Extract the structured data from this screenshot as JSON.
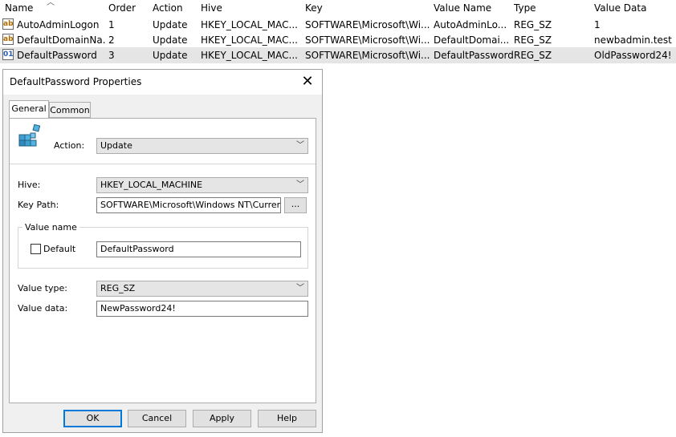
{
  "list": {
    "columns": [
      "Name",
      "Order",
      "Action",
      "Hive",
      "Key",
      "Value Name",
      "Type",
      "Value Data"
    ],
    "rows": [
      {
        "icon": "string-value-icon",
        "name": "AutoAdminLogon",
        "order": "1",
        "action": "Update",
        "hive": "HKEY_LOCAL_MAC...",
        "key": "SOFTWARE\\Microsoft\\Wi...",
        "value_name": "AutoAdminLo...",
        "type": "REG_SZ",
        "value_data": "1"
      },
      {
        "icon": "string-value-icon",
        "name": "DefaultDomainNa...",
        "order": "2",
        "action": "Update",
        "hive": "HKEY_LOCAL_MAC...",
        "key": "SOFTWARE\\Microsoft\\Wi...",
        "value_name": "DefaultDomai...",
        "type": "REG_SZ",
        "value_data": "newbadmin.test"
      },
      {
        "icon": "binary-value-icon",
        "name": "DefaultPassword",
        "order": "3",
        "action": "Update",
        "hive": "HKEY_LOCAL_MAC...",
        "key": "SOFTWARE\\Microsoft\\Wi...",
        "value_name": "DefaultPassword",
        "type": "REG_SZ",
        "value_data": "OldPassword24!"
      }
    ]
  },
  "dialog": {
    "title": "DefaultPassword Properties",
    "close_glyph": "✕",
    "tabs": [
      "General",
      "Common"
    ],
    "action_label": "Action:",
    "action_value": "Update",
    "hive_label": "Hive:",
    "hive_value": "HKEY_LOCAL_MACHINE",
    "key_path_label": "Key Path:",
    "key_path_value": "SOFTWARE\\Microsoft\\Windows NT\\CurrentVer",
    "browse_label": "...",
    "value_name_group": "Value name",
    "default_label": "Default",
    "value_name_value": "DefaultPassword",
    "value_type_label": "Value type:",
    "value_type_value": "REG_SZ",
    "value_data_label": "Value data:",
    "value_data_value": "NewPassword24!",
    "buttons": {
      "ok": "OK",
      "cancel": "Cancel",
      "apply": "Apply",
      "help": "Help"
    }
  },
  "colors": {
    "selected_row": "#e5e5e5",
    "dialog_bg": "#f0f0f0",
    "default_button_border": "#0078d7"
  }
}
